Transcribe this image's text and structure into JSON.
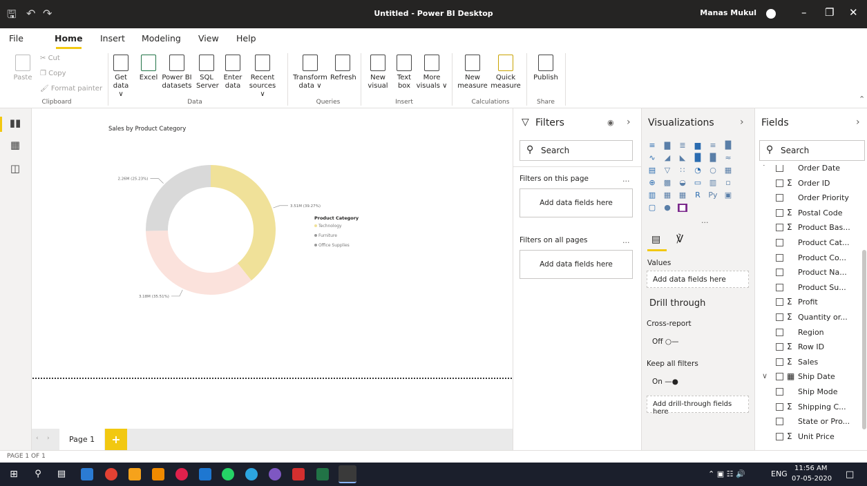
{
  "window": {
    "title": "Untitled - Power BI Desktop",
    "user": "Manas Mukul"
  },
  "menu": [
    "File",
    "Home",
    "Insert",
    "Modeling",
    "View",
    "Help"
  ],
  "ribbon": {
    "clipboard": {
      "paste": "Paste",
      "cut": "Cut",
      "copy": "Copy",
      "format_painter": "Format painter",
      "group": "Clipboard"
    },
    "data": {
      "get_data": "Get data ∨",
      "excel": "Excel",
      "powerbi": "Power BI datasets",
      "sql": "SQL Server",
      "enter": "Enter data",
      "recent": "Recent sources ∨",
      "group": "Data"
    },
    "queries": {
      "transform": "Transform data ∨",
      "refresh": "Refresh",
      "group": "Queries"
    },
    "insert": {
      "new_visual": "New visual",
      "text_box": "Text box",
      "more_visuals": "More visuals ∨",
      "group": "Insert"
    },
    "calculations": {
      "new_measure": "New measure",
      "quick_measure": "Quick measure",
      "group": "Calculations"
    },
    "share": {
      "publish": "Publish",
      "group": "Share"
    }
  },
  "chart_data": {
    "type": "pie",
    "title": "Sales by Product Category",
    "legend_title": "Product Category",
    "legend_position": "right",
    "categories": [
      "Technology",
      "Furniture",
      "Office Supplies"
    ],
    "values": [
      3.51,
      3.18,
      2.26
    ],
    "data_labels": [
      "3.51M (39.27%)",
      "3.18M (35.51%)",
      "2.26M (25.23%)"
    ],
    "colors": [
      "#f0e199",
      "#fbe2dc",
      "#d9d9d9"
    ]
  },
  "pages": {
    "tab": "Page 1",
    "add": "+",
    "status": "PAGE 1 OF 1"
  },
  "filters": {
    "title": "Filters",
    "search": "Search",
    "on_page": "Filters on this page",
    "on_all": "Filters on all pages",
    "add_here": "Add data fields here",
    "more": "..."
  },
  "visualizations": {
    "title": "Visualizations",
    "values_label": "Values",
    "values_drop": "Add data fields here",
    "drill_title": "Drill through",
    "cross_report": "Cross-report",
    "cross_state": "Off",
    "keep_filters": "Keep all filters",
    "keep_state": "On",
    "drill_drop": "Add drill-through fields here",
    "more": "..."
  },
  "fields": {
    "title": "Fields",
    "search": "Search",
    "items": [
      {
        "label": "Order Date",
        "sigma": "",
        "exp": "˅"
      },
      {
        "label": "Order ID",
        "sigma": "Σ",
        "exp": ""
      },
      {
        "label": "Order Priority",
        "sigma": "",
        "exp": ""
      },
      {
        "label": "Postal Code",
        "sigma": "Σ",
        "exp": ""
      },
      {
        "label": "Product Bas...",
        "sigma": "Σ",
        "exp": ""
      },
      {
        "label": "Product Cat...",
        "sigma": "",
        "exp": ""
      },
      {
        "label": "Product Co...",
        "sigma": "",
        "exp": ""
      },
      {
        "label": "Product Na...",
        "sigma": "",
        "exp": ""
      },
      {
        "label": "Product Su...",
        "sigma": "",
        "exp": ""
      },
      {
        "label": "Profit",
        "sigma": "Σ",
        "exp": ""
      },
      {
        "label": "Quantity or...",
        "sigma": "Σ",
        "exp": ""
      },
      {
        "label": "Region",
        "sigma": "",
        "exp": ""
      },
      {
        "label": "Row ID",
        "sigma": "Σ",
        "exp": ""
      },
      {
        "label": "Sales",
        "sigma": "Σ",
        "exp": ""
      },
      {
        "label": "Ship Date",
        "sigma": "▦",
        "exp": "∨"
      },
      {
        "label": "Ship Mode",
        "sigma": "",
        "exp": ""
      },
      {
        "label": "Shipping C...",
        "sigma": "Σ",
        "exp": ""
      },
      {
        "label": "State or Pro...",
        "sigma": "",
        "exp": ""
      },
      {
        "label": "Unit Price",
        "sigma": "Σ",
        "exp": ""
      }
    ]
  },
  "taskbar": {
    "lang": "ENG",
    "time": "11:56 AM",
    "date": "07-05-2020"
  },
  "accent": "#f2c811"
}
